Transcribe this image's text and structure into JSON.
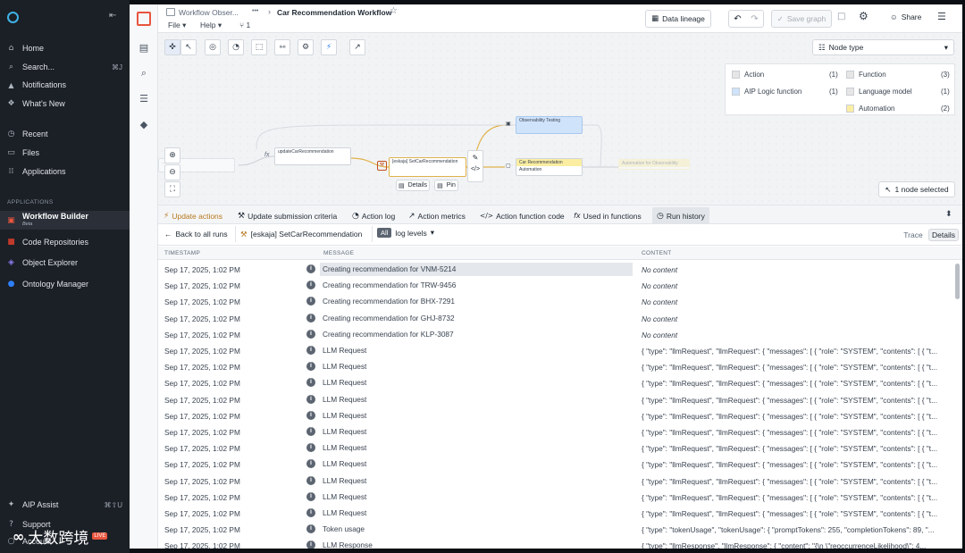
{
  "app": {
    "logo": "logo-icon",
    "collapse": "⇤"
  },
  "sidebar": {
    "items": [
      {
        "label": "Home",
        "icon": "⌂",
        "kbd": ""
      },
      {
        "label": "Search...",
        "icon": "⌕",
        "kbd": "⌘J"
      },
      {
        "label": "Notifications",
        "icon": "🔔",
        "kbd": ""
      },
      {
        "label": "What's New",
        "icon": "❖",
        "kbd": ""
      }
    ],
    "items2": [
      {
        "label": "Recent",
        "icon": "◷"
      },
      {
        "label": "Files",
        "icon": "▭"
      },
      {
        "label": "Applications",
        "icon": "⁞⁞"
      }
    ],
    "apps_header": "APPLICATIONS",
    "apps": [
      {
        "label": "Workflow Builder",
        "sub": "Beta",
        "color": "#e8553e"
      },
      {
        "label": "Code Repositories",
        "sub": "",
        "color": "#c0392b"
      },
      {
        "label": "Object Explorer",
        "sub": "",
        "color": "#6c5ce7"
      },
      {
        "label": "Ontology Manager",
        "sub": "",
        "color": "#2d7ff9"
      }
    ],
    "bottom": [
      {
        "label": "AIP Assist",
        "kbd": "⌘⇧U"
      },
      {
        "label": "Support",
        "kbd": ""
      },
      {
        "label": "Account",
        "kbd": ""
      }
    ],
    "watermark": "大数跨境",
    "watermark_badge": "LIVE"
  },
  "header": {
    "breadcrumb": "Workflow Obser...",
    "dots": "•••",
    "sep": "›",
    "title": "Car Recommendation Workflow",
    "menu": [
      "File",
      "Help"
    ],
    "count": "1",
    "data_lineage": "Data lineage",
    "save_graph": "Save graph",
    "share": "Share"
  },
  "canvas": {
    "node_type_select": "Node type",
    "legend": [
      {
        "label": "Action",
        "count": "(1)",
        "color": "#e6e6e6"
      },
      {
        "label": "Function",
        "count": "(3)",
        "color": "#e6e6e6"
      },
      {
        "label": "AIP Logic function",
        "count": "(1)",
        "color": "#cfe3fb"
      },
      {
        "label": "Language model",
        "count": "(1)",
        "color": "#e6e6e6"
      },
      {
        "label": "Automation",
        "count": "(2)",
        "color": "#fbeea2"
      }
    ],
    "nodes": {
      "left": "...",
      "update": "updateCarRecommendation",
      "selected": "[eskaja] SetCarRecommendation",
      "testing": "Observability Testing",
      "automation": "Car Recommendation Automation",
      "far": "Automation for Observability"
    },
    "node_details": "Details",
    "node_pin": "Pin",
    "selection_count": "1 node selected"
  },
  "tabs": [
    {
      "label": "Update actions",
      "icon": "⚡",
      "active": true
    },
    {
      "label": "Update submission criteria",
      "icon": "✎"
    },
    {
      "label": "Action log",
      "icon": "◔"
    },
    {
      "label": "Action metrics",
      "icon": "⟋"
    },
    {
      "label": "Action function code",
      "icon": "</>"
    },
    {
      "label": "Used in functions",
      "icon": "fx"
    },
    {
      "label": "Run history",
      "icon": "◷"
    }
  ],
  "subbar": {
    "back": "Back to all runs",
    "run_name": "[eskaja] SetCarRecommendation",
    "all": "All",
    "levels": "log levels",
    "trace": "Trace",
    "details": "Details"
  },
  "table": {
    "headers": [
      "TIMESTAMP",
      "MESSAGE",
      "CONTENT"
    ],
    "rows": [
      {
        "ts": "Sep 17, 2025, 1:02 PM",
        "msg": "Creating recommendation for VNM-5214",
        "content": "No content",
        "nc": true,
        "hl": true
      },
      {
        "ts": "Sep 17, 2025, 1:02 PM",
        "msg": "Creating recommendation for TRW-9456",
        "content": "No content",
        "nc": true
      },
      {
        "ts": "Sep 17, 2025, 1:02 PM",
        "msg": "Creating recommendation for BHX-7291",
        "content": "No content",
        "nc": true
      },
      {
        "ts": "Sep 17, 2025, 1:02 PM",
        "msg": "Creating recommendation for GHJ-8732",
        "content": "No content",
        "nc": true
      },
      {
        "ts": "Sep 17, 2025, 1:02 PM",
        "msg": "Creating recommendation for KLP-3087",
        "content": "No content",
        "nc": true
      },
      {
        "ts": "Sep 17, 2025, 1:02 PM",
        "msg": "LLM Request",
        "content": "{ \"type\": \"llmRequest\", \"llmRequest\": { \"messages\": [ { \"role\": \"SYSTEM\", \"contents\": [ { \"t..."
      },
      {
        "ts": "Sep 17, 2025, 1:02 PM",
        "msg": "LLM Request",
        "content": "{ \"type\": \"llmRequest\", \"llmRequest\": { \"messages\": [ { \"role\": \"SYSTEM\", \"contents\": [ { \"t..."
      },
      {
        "ts": "Sep 17, 2025, 1:02 PM",
        "msg": "LLM Request",
        "content": "{ \"type\": \"llmRequest\", \"llmRequest\": { \"messages\": [ { \"role\": \"SYSTEM\", \"contents\": [ { \"t..."
      },
      {
        "ts": "Sep 17, 2025, 1:02 PM",
        "msg": "LLM Request",
        "content": "{ \"type\": \"llmRequest\", \"llmRequest\": { \"messages\": [ { \"role\": \"SYSTEM\", \"contents\": [ { \"t..."
      },
      {
        "ts": "Sep 17, 2025, 1:02 PM",
        "msg": "LLM Request",
        "content": "{ \"type\": \"llmRequest\", \"llmRequest\": { \"messages\": [ { \"role\": \"SYSTEM\", \"contents\": [ { \"t..."
      },
      {
        "ts": "Sep 17, 2025, 1:02 PM",
        "msg": "LLM Request",
        "content": "{ \"type\": \"llmRequest\", \"llmRequest\": { \"messages\": [ { \"role\": \"SYSTEM\", \"contents\": [ { \"t..."
      },
      {
        "ts": "Sep 17, 2025, 1:02 PM",
        "msg": "LLM Request",
        "content": "{ \"type\": \"llmRequest\", \"llmRequest\": { \"messages\": [ { \"role\": \"SYSTEM\", \"contents\": [ { \"t..."
      },
      {
        "ts": "Sep 17, 2025, 1:02 PM",
        "msg": "LLM Request",
        "content": "{ \"type\": \"llmRequest\", \"llmRequest\": { \"messages\": [ { \"role\": \"SYSTEM\", \"contents\": [ { \"t..."
      },
      {
        "ts": "Sep 17, 2025, 1:02 PM",
        "msg": "LLM Request",
        "content": "{ \"type\": \"llmRequest\", \"llmRequest\": { \"messages\": [ { \"role\": \"SYSTEM\", \"contents\": [ { \"t..."
      },
      {
        "ts": "Sep 17, 2025, 1:02 PM",
        "msg": "LLM Request",
        "content": "{ \"type\": \"llmRequest\", \"llmRequest\": { \"messages\": [ { \"role\": \"SYSTEM\", \"contents\": [ { \"t..."
      },
      {
        "ts": "Sep 17, 2025, 1:02 PM",
        "msg": "LLM Request",
        "content": "{ \"type\": \"llmRequest\", \"llmRequest\": { \"messages\": [ { \"role\": \"SYSTEM\", \"contents\": [ { \"t..."
      },
      {
        "ts": "Sep 17, 2025, 1:02 PM",
        "msg": "Token usage",
        "content": "{ \"type\": \"tokenUsage\", \"tokenUsage\": { \"promptTokens\": 255, \"completionTokens\": 89, \"..."
      },
      {
        "ts": "Sep 17, 2025, 1:02 PM",
        "msg": "LLM Response",
        "content": "{ \"type\": \"llmResponse\", \"llmResponse\": { \"content\": \"{\\n \\\"reoccurrenceLikelihood\\\": 4..."
      }
    ]
  }
}
